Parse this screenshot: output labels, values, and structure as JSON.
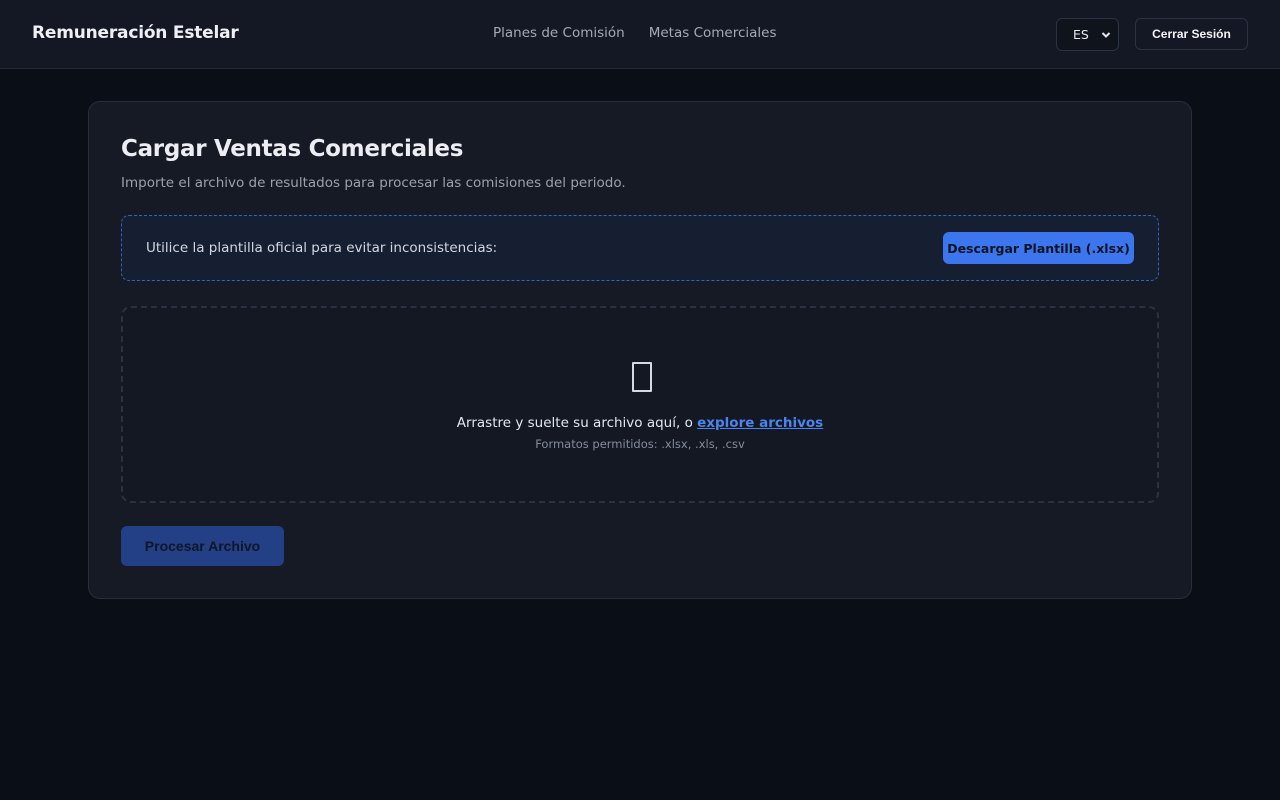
{
  "header": {
    "brand": "Remuneración Estelar",
    "nav": [
      {
        "label": "Planes de Comisión"
      },
      {
        "label": "Metas Comerciales"
      }
    ],
    "language": {
      "selected": "ES"
    },
    "logout_label": "Cerrar Sesión"
  },
  "upload": {
    "title": "Cargar Ventas Comerciales",
    "subtitle": "Importe el archivo de resultados para procesar las comisiones del periodo.",
    "template_text": "Utilice la plantilla oficial para evitar inconsistencias:",
    "download_label": "Descargar Plantilla (.xlsx)",
    "drop_text": "Arrastre y suelte su archivo aquí, o",
    "browse_link": "explore archivos",
    "formats": "Formatos permitidos: .xlsx, .xls, .csv",
    "upload_icon": "file-icon",
    "process_label": "Procesar Archivo"
  },
  "colors": {
    "background": "#0a0e17",
    "accent": "#3b76ee",
    "accent_disabled": "#233f86"
  }
}
